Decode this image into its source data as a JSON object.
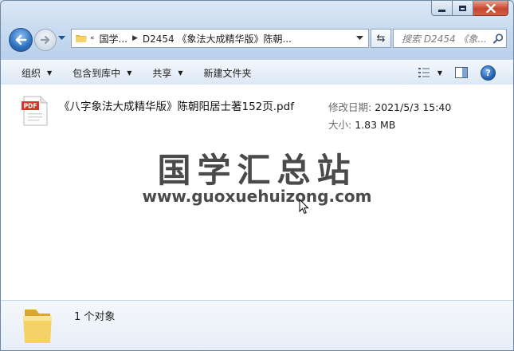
{
  "window": {
    "caption_icons": [
      "minimize-icon",
      "maximize-icon",
      "close-icon"
    ]
  },
  "navigation": {
    "address_segments": [
      "国学...",
      "D2454 《象法大成精华版》陈朝..."
    ],
    "search_placeholder": "搜索 D2454 《象..."
  },
  "toolbar": {
    "organize": "组织",
    "include_in_library": "包含到库中",
    "share": "共享",
    "new_folder": "新建文件夹",
    "help": "?"
  },
  "files": [
    {
      "name": "《八字象法大成精华版》陈朝阳居士著152页.pdf",
      "icon": "pdf-icon",
      "icon_label": "PDF",
      "date_label": "修改日期:",
      "date": "2021/5/3 15:40",
      "size_label": "大小:",
      "size": "1.83 MB"
    }
  ],
  "watermark": {
    "title": "国学汇总站",
    "url": "www.guoxuehuizong.com"
  },
  "details": {
    "count": "1 个对象"
  },
  "colors": {
    "accent": "#2e6fbd",
    "pdf_red": "#d9342b",
    "folder_yellow": "#f2c24e"
  }
}
